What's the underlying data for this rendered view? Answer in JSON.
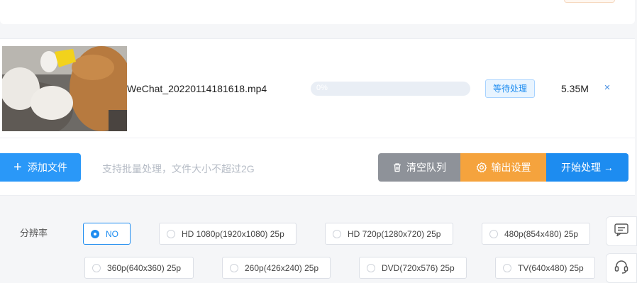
{
  "file": {
    "name": "WeChat_20220114181618.mp4",
    "progress_text": "0%",
    "progress": 0,
    "status": "等待处理",
    "size": "5.35M",
    "remove_symbol": "×"
  },
  "actions": {
    "add_label": "添加文件",
    "hint": "支持批量处理，文件大小不超过2G",
    "clear_label": "清空队列",
    "output_label": "输出设置",
    "start_label": "开始处理 →"
  },
  "settings": {
    "resolution_label": "分辨率",
    "options": [
      {
        "label": "NO",
        "selected": true
      },
      {
        "label": "HD 1080p(1920x1080) 25p",
        "selected": false
      },
      {
        "label": "HD 720p(1280x720) 25p",
        "selected": false
      },
      {
        "label": "480p(854x480) 25p",
        "selected": false
      },
      {
        "label": "360p(640x360) 25p",
        "selected": false
      },
      {
        "label": "260p(426x240) 25p",
        "selected": false
      },
      {
        "label": "DVD(720x576) 25p",
        "selected": false
      },
      {
        "label": "TV(640x480) 25p",
        "selected": false
      }
    ]
  },
  "colors": {
    "primary": "#1d8cf0",
    "orange": "#f5a33d",
    "gray": "#8e9299"
  },
  "icons": {
    "remove": "close-icon",
    "clear": "trash-icon",
    "output": "gear-icon",
    "add": "plus-icon",
    "feedback": "message-icon",
    "support": "headset-icon"
  }
}
